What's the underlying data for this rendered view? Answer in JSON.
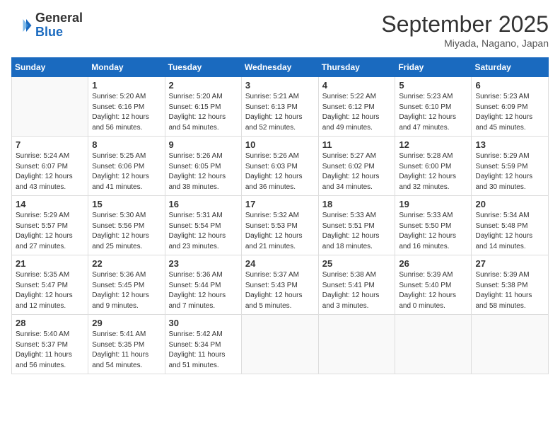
{
  "header": {
    "logo_general": "General",
    "logo_blue": "Blue",
    "month_title": "September 2025",
    "subtitle": "Miyada, Nagano, Japan"
  },
  "columns": [
    "Sunday",
    "Monday",
    "Tuesday",
    "Wednesday",
    "Thursday",
    "Friday",
    "Saturday"
  ],
  "weeks": [
    [
      {
        "day": "",
        "info": ""
      },
      {
        "day": "1",
        "info": "Sunrise: 5:20 AM\nSunset: 6:16 PM\nDaylight: 12 hours\nand 56 minutes."
      },
      {
        "day": "2",
        "info": "Sunrise: 5:20 AM\nSunset: 6:15 PM\nDaylight: 12 hours\nand 54 minutes."
      },
      {
        "day": "3",
        "info": "Sunrise: 5:21 AM\nSunset: 6:13 PM\nDaylight: 12 hours\nand 52 minutes."
      },
      {
        "day": "4",
        "info": "Sunrise: 5:22 AM\nSunset: 6:12 PM\nDaylight: 12 hours\nand 49 minutes."
      },
      {
        "day": "5",
        "info": "Sunrise: 5:23 AM\nSunset: 6:10 PM\nDaylight: 12 hours\nand 47 minutes."
      },
      {
        "day": "6",
        "info": "Sunrise: 5:23 AM\nSunset: 6:09 PM\nDaylight: 12 hours\nand 45 minutes."
      }
    ],
    [
      {
        "day": "7",
        "info": "Sunrise: 5:24 AM\nSunset: 6:07 PM\nDaylight: 12 hours\nand 43 minutes."
      },
      {
        "day": "8",
        "info": "Sunrise: 5:25 AM\nSunset: 6:06 PM\nDaylight: 12 hours\nand 41 minutes."
      },
      {
        "day": "9",
        "info": "Sunrise: 5:26 AM\nSunset: 6:05 PM\nDaylight: 12 hours\nand 38 minutes."
      },
      {
        "day": "10",
        "info": "Sunrise: 5:26 AM\nSunset: 6:03 PM\nDaylight: 12 hours\nand 36 minutes."
      },
      {
        "day": "11",
        "info": "Sunrise: 5:27 AM\nSunset: 6:02 PM\nDaylight: 12 hours\nand 34 minutes."
      },
      {
        "day": "12",
        "info": "Sunrise: 5:28 AM\nSunset: 6:00 PM\nDaylight: 12 hours\nand 32 minutes."
      },
      {
        "day": "13",
        "info": "Sunrise: 5:29 AM\nSunset: 5:59 PM\nDaylight: 12 hours\nand 30 minutes."
      }
    ],
    [
      {
        "day": "14",
        "info": "Sunrise: 5:29 AM\nSunset: 5:57 PM\nDaylight: 12 hours\nand 27 minutes."
      },
      {
        "day": "15",
        "info": "Sunrise: 5:30 AM\nSunset: 5:56 PM\nDaylight: 12 hours\nand 25 minutes."
      },
      {
        "day": "16",
        "info": "Sunrise: 5:31 AM\nSunset: 5:54 PM\nDaylight: 12 hours\nand 23 minutes."
      },
      {
        "day": "17",
        "info": "Sunrise: 5:32 AM\nSunset: 5:53 PM\nDaylight: 12 hours\nand 21 minutes."
      },
      {
        "day": "18",
        "info": "Sunrise: 5:33 AM\nSunset: 5:51 PM\nDaylight: 12 hours\nand 18 minutes."
      },
      {
        "day": "19",
        "info": "Sunrise: 5:33 AM\nSunset: 5:50 PM\nDaylight: 12 hours\nand 16 minutes."
      },
      {
        "day": "20",
        "info": "Sunrise: 5:34 AM\nSunset: 5:48 PM\nDaylight: 12 hours\nand 14 minutes."
      }
    ],
    [
      {
        "day": "21",
        "info": "Sunrise: 5:35 AM\nSunset: 5:47 PM\nDaylight: 12 hours\nand 12 minutes."
      },
      {
        "day": "22",
        "info": "Sunrise: 5:36 AM\nSunset: 5:45 PM\nDaylight: 12 hours\nand 9 minutes."
      },
      {
        "day": "23",
        "info": "Sunrise: 5:36 AM\nSunset: 5:44 PM\nDaylight: 12 hours\nand 7 minutes."
      },
      {
        "day": "24",
        "info": "Sunrise: 5:37 AM\nSunset: 5:43 PM\nDaylight: 12 hours\nand 5 minutes."
      },
      {
        "day": "25",
        "info": "Sunrise: 5:38 AM\nSunset: 5:41 PM\nDaylight: 12 hours\nand 3 minutes."
      },
      {
        "day": "26",
        "info": "Sunrise: 5:39 AM\nSunset: 5:40 PM\nDaylight: 12 hours\nand 0 minutes."
      },
      {
        "day": "27",
        "info": "Sunrise: 5:39 AM\nSunset: 5:38 PM\nDaylight: 11 hours\nand 58 minutes."
      }
    ],
    [
      {
        "day": "28",
        "info": "Sunrise: 5:40 AM\nSunset: 5:37 PM\nDaylight: 11 hours\nand 56 minutes."
      },
      {
        "day": "29",
        "info": "Sunrise: 5:41 AM\nSunset: 5:35 PM\nDaylight: 11 hours\nand 54 minutes."
      },
      {
        "day": "30",
        "info": "Sunrise: 5:42 AM\nSunset: 5:34 PM\nDaylight: 11 hours\nand 51 minutes."
      },
      {
        "day": "",
        "info": ""
      },
      {
        "day": "",
        "info": ""
      },
      {
        "day": "",
        "info": ""
      },
      {
        "day": "",
        "info": ""
      }
    ]
  ]
}
